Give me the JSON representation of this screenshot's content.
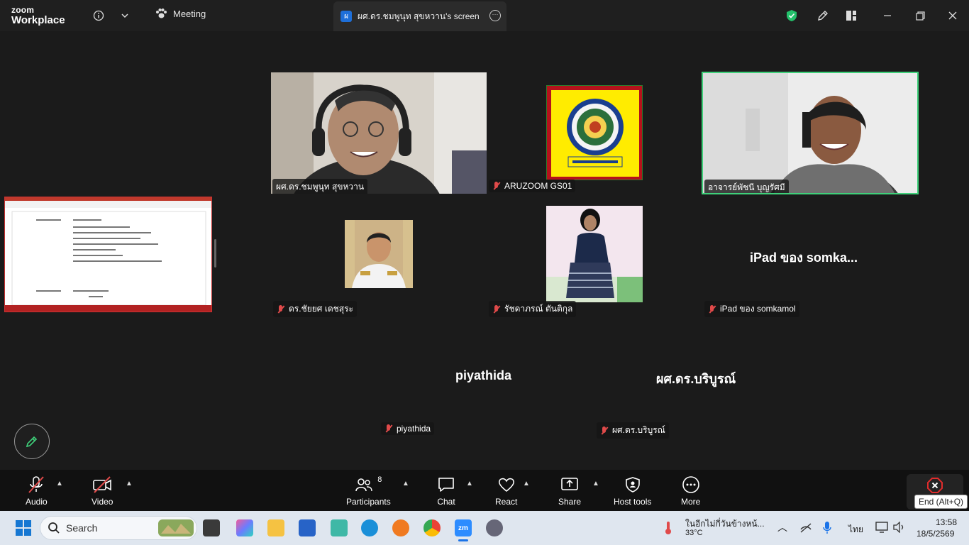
{
  "app": {
    "logo_line1": "zoom",
    "logo_line2": "Workplace",
    "tab_meeting": "Meeting",
    "tab_screen": "ผศ.ดร.ชมพูนุท  สุขหวาน's screen",
    "tab_screen_badge": "ผ"
  },
  "participants": [
    {
      "name": "ผศ.ดร.ชมพูนุท  สุขหวาน",
      "muted": false
    },
    {
      "name": "ARUZOOM GS01",
      "muted": true
    },
    {
      "name": "อาจารย์พัชนี  บุญรัศมี",
      "muted": false
    },
    {
      "name": "ดร.ชัยยศ  เดชสุระ",
      "muted": true
    },
    {
      "name": "รัชดาภรณ์  ตันติกุล",
      "muted": true
    },
    {
      "name": "iPad ของ somkamol",
      "muted": true,
      "display": "iPad ของ somka..."
    },
    {
      "name": "piyathida",
      "muted": true,
      "display": "piyathida"
    },
    {
      "name": "ผศ.ดร.บริบูรณ์",
      "muted": true,
      "display": "ผศ.ดร.บริบูรณ์"
    }
  ],
  "controls": {
    "audio": "Audio",
    "video": "Video",
    "participants": "Participants",
    "participants_count": "8",
    "chat": "Chat",
    "react": "React",
    "share": "Share",
    "host_tools": "Host tools",
    "more": "More",
    "end_tooltip": "End (Alt+Q)"
  },
  "taskbar": {
    "search_placeholder": "Search",
    "weather_text": "ในอีกไม่กี่วันข้างหน้...",
    "temperature": "33°C",
    "language": "ไทย",
    "time": "13:58",
    "date": "18/5/2569"
  },
  "colors": {
    "accent": "#2d8cff",
    "active_speaker": "#3fd07a",
    "muted": "#e04a4a",
    "end": "#e02c2c"
  }
}
